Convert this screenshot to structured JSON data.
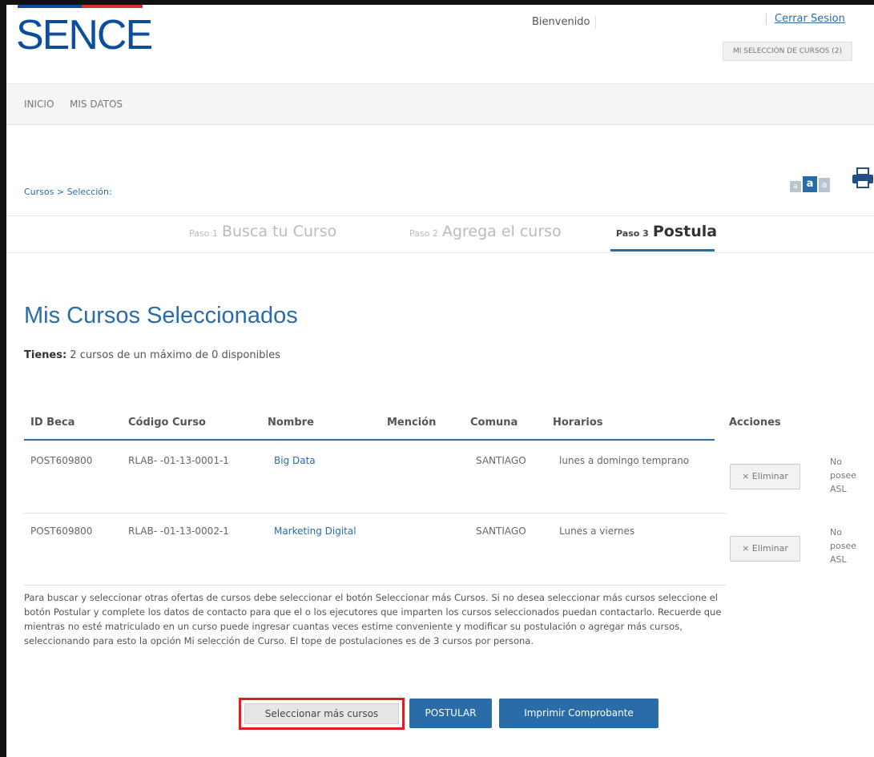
{
  "header": {
    "logo": "SENCE",
    "welcome": "Bienvenido",
    "logout_label": "Cerrar Sesion",
    "my_selection_label": "MI SELECCIÓN DE CURSOS (2)"
  },
  "nav": {
    "items": [
      {
        "label": "INICIO"
      },
      {
        "label": "MIS DATOS"
      }
    ]
  },
  "breadcrumb": "Cursos > Selección:",
  "font_sizes": [
    "a",
    "a",
    "a"
  ],
  "steps": [
    {
      "num": "Paso 1",
      "label": "Busca tu Curso",
      "active": false
    },
    {
      "num": "Paso 2",
      "label": "Agrega el curso",
      "active": false
    },
    {
      "num": "Paso 3",
      "label": "Postula",
      "active": true
    }
  ],
  "main": {
    "title": "Mis Cursos Seleccionados",
    "summary_label": "Tienes:",
    "summary_text": "2 cursos de un máximo de 0 disponibles"
  },
  "table": {
    "headers": [
      "ID Beca",
      "Código Curso",
      "Nombre",
      "Mención",
      "Comuna",
      "Horarios",
      "Acciones"
    ],
    "rows": [
      {
        "id_beca": "POST609800",
        "codigo": "RLAB-   -01-13-0001-1",
        "nombre": "Big Data",
        "mencion": "",
        "comuna": "SANTIAGO",
        "horarios": "lunes a domingo temprano",
        "accion": "× Eliminar",
        "asl": "No posee ASL"
      },
      {
        "id_beca": "POST609800",
        "codigo": "RLAB-   -01-13-0002-1",
        "nombre": "Marketing Digital",
        "mencion": "",
        "comuna": "SANTIAGO",
        "horarios": "Lunes a viernes",
        "accion": "× Eliminar",
        "asl": "No posee ASL"
      }
    ]
  },
  "info_paragraph": "Para buscar y seleccionar otras ofertas de cursos debe seleccionar el botón Seleccionar más Cursos. Si no desea seleccionar más cursos seleccione el botón Postular y complete los datos de contacto para que el o los ejecutores que imparten los cursos seleccionados puedan contactarlo. Recuerde que mientras no esté matriculado en un curso puede ingresar cuantas veces estime conveniente y modificar su postulación o agregar más cursos, seleccionando para esto la opción Mi selección de Curso. El tope de postulaciones es de 3 cursos por persona.",
  "actions": {
    "select_more": "Seleccionar más cursos",
    "postular": "POSTULAR",
    "print": "Imprimir Comprobante"
  },
  "colors": {
    "brand_blue": "#0b4f9c",
    "brand_red": "#d4302f",
    "link_blue": "#2a6ca8",
    "highlight_red": "#e31b23"
  }
}
